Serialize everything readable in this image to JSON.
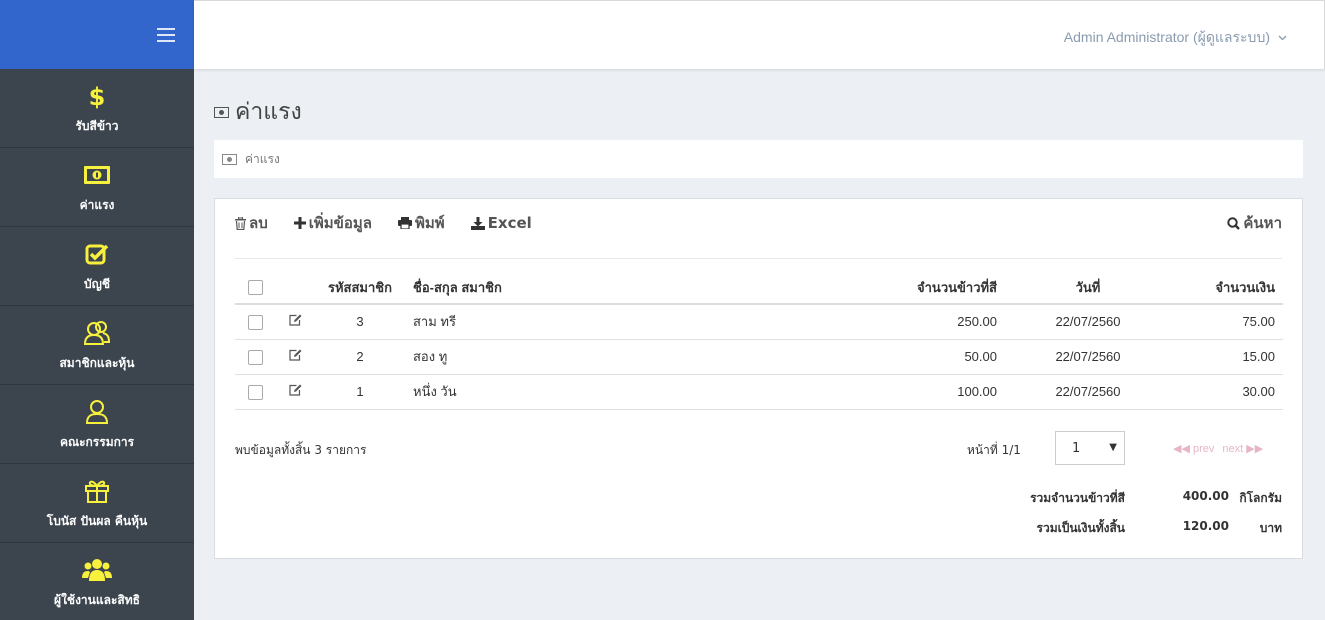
{
  "sidebar": {
    "items": [
      {
        "icon": "dollar-icon",
        "label": "รับสีข้าว"
      },
      {
        "icon": "money-icon",
        "label": "ค่าแรง"
      },
      {
        "icon": "check-square-icon",
        "label": "บัญชี"
      },
      {
        "icon": "users-icon",
        "label": "สมาชิกและหุ้น"
      },
      {
        "icon": "user-icon",
        "label": "คณะกรรมการ"
      },
      {
        "icon": "gift-icon",
        "label": "โบนัส ปันผล คืนหุ้น"
      },
      {
        "icon": "group-icon",
        "label": "ผู้ใช้งานและสิทธิ"
      }
    ]
  },
  "header": {
    "user": "Admin Administrator (ผู้ดูแลระบบ)"
  },
  "page": {
    "title": "ค่าแรง",
    "breadcrumb": "ค่าแรง"
  },
  "toolbar": {
    "delete": "ลบ",
    "add": "เพิ่มข้อมูล",
    "print": "พิมพ์",
    "excel": "Excel",
    "search": "ค้นหา"
  },
  "table": {
    "headers": {
      "code": "รหัสสมาชิก",
      "name": "ชื่อ-สกุล สมาชิก",
      "amount": "จำนวนข้าวที่สี",
      "date": "วันที่",
      "money": "จำนวนเงิน"
    },
    "rows": [
      {
        "code": "3",
        "name": "สาม ทรี",
        "amount": "250.00",
        "date": "22/07/2560",
        "money": "75.00"
      },
      {
        "code": "2",
        "name": "สอง ทู",
        "amount": "50.00",
        "date": "22/07/2560",
        "money": "15.00"
      },
      {
        "code": "1",
        "name": "หนึ่ง วัน",
        "amount": "100.00",
        "date": "22/07/2560",
        "money": "30.00"
      }
    ]
  },
  "footer": {
    "found": "พบข้อมูลทั้งสิ้น 3 รายการ",
    "page_info": "หน้าที่ 1/1",
    "page_select": "1",
    "prev": "prev",
    "next": "next"
  },
  "summary": {
    "rice_label": "รวมจำนวนข้าวที่สี",
    "rice_value": "400.00",
    "rice_unit": "กิโลกรัม",
    "money_label": "รวมเป็นเงินทั้งสิ้น",
    "money_value": "120.00",
    "money_unit": "บาท"
  },
  "colors": {
    "sidebar_bg": "#3c454e",
    "brand_bg": "#3366cc",
    "icon_yellow": "#f7f03c",
    "content_bg": "#ecf0f5"
  }
}
